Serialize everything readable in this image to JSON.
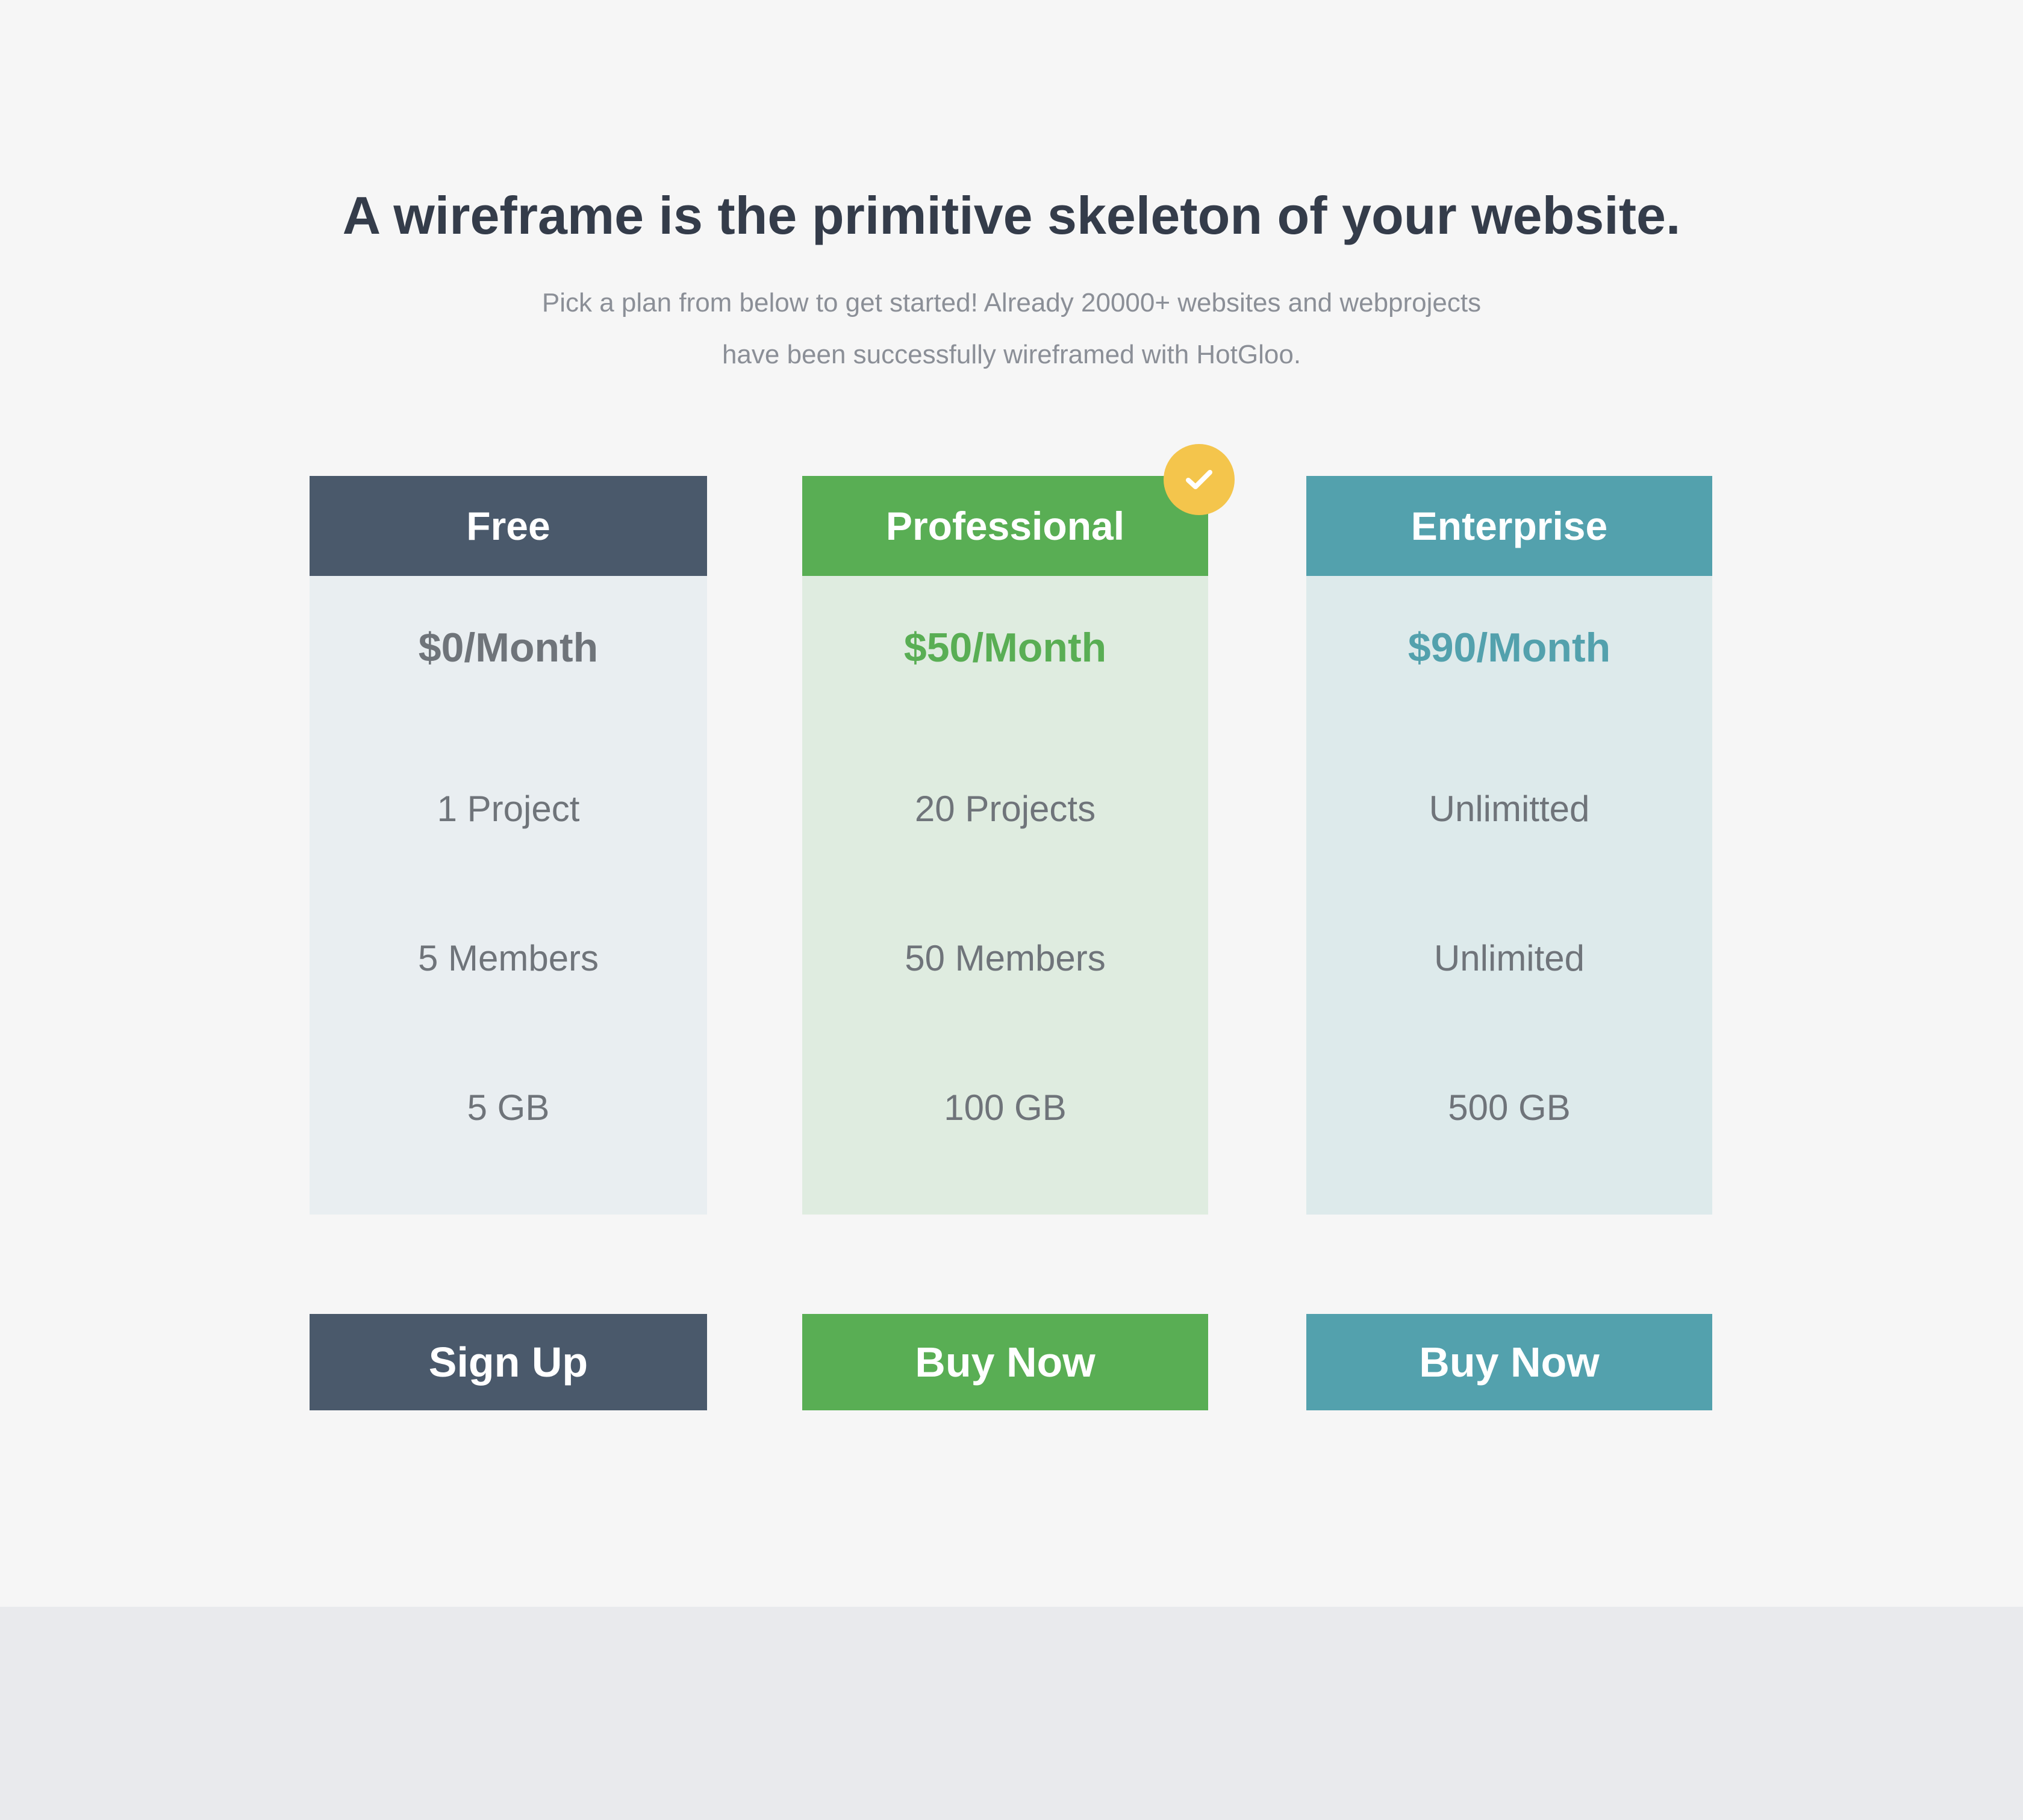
{
  "header": {
    "title": "A wireframe is the primitive skeleton of your website.",
    "subtitle_line1": "Pick a plan from below to get started! Already 20000+ websites and webprojects",
    "subtitle_line2": "have been successfully wireframed with HotGloo."
  },
  "plans": [
    {
      "name": "Free",
      "price": "$0/Month",
      "features": [
        "1 Project",
        "5 Members",
        "5 GB"
      ],
      "cta": "Sign Up",
      "color": "#4a596b"
    },
    {
      "name": "Professional",
      "price": "$50/Month",
      "features": [
        "20 Projects",
        "50 Members",
        "100 GB"
      ],
      "cta": "Buy Now",
      "color": "#59ae54",
      "highlighted": true,
      "badge_icon": "check-icon",
      "badge_color": "#f4c54c"
    },
    {
      "name": "Enterprise",
      "price": "$90/Month",
      "features": [
        "Unlimitted",
        "Unlimited",
        "500 GB"
      ],
      "cta": "Buy Now",
      "color": "#53a1ad"
    }
  ]
}
